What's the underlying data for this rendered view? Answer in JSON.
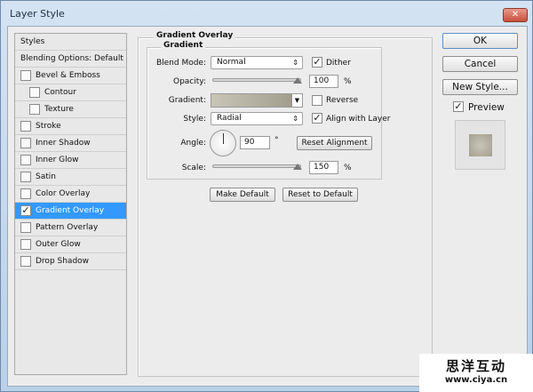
{
  "window": {
    "title": "Layer Style",
    "close": "✕"
  },
  "sidebar": {
    "items": [
      {
        "label": "Styles",
        "checkbox": false
      },
      {
        "label": "Blending Options: Default",
        "checkbox": false
      },
      {
        "label": "Bevel & Emboss",
        "checkbox": true,
        "checked": false
      },
      {
        "label": "Contour",
        "checkbox": true,
        "checked": false,
        "indent": true
      },
      {
        "label": "Texture",
        "checkbox": true,
        "checked": false,
        "indent": true
      },
      {
        "label": "Stroke",
        "checkbox": true,
        "checked": false
      },
      {
        "label": "Inner Shadow",
        "checkbox": true,
        "checked": false
      },
      {
        "label": "Inner Glow",
        "checkbox": true,
        "checked": false
      },
      {
        "label": "Satin",
        "checkbox": true,
        "checked": false
      },
      {
        "label": "Color Overlay",
        "checkbox": true,
        "checked": false
      },
      {
        "label": "Gradient Overlay",
        "checkbox": true,
        "checked": true,
        "selected": true
      },
      {
        "label": "Pattern Overlay",
        "checkbox": true,
        "checked": false
      },
      {
        "label": "Outer Glow",
        "checkbox": true,
        "checked": false
      },
      {
        "label": "Drop Shadow",
        "checkbox": true,
        "checked": false
      }
    ]
  },
  "panel": {
    "title": "Gradient Overlay",
    "group": "Gradient",
    "blend_mode_label": "Blend Mode:",
    "blend_mode": "Normal",
    "dither_label": "Dither",
    "dither": true,
    "opacity_label": "Opacity:",
    "opacity": "100",
    "opacity_unit": "%",
    "gradient_label": "Gradient:",
    "gradient_colors": [
      "#c8c5b7",
      "#a39f8f"
    ],
    "reverse_label": "Reverse",
    "reverse": false,
    "style_label": "Style:",
    "style": "Radial",
    "align_label": "Align with Layer",
    "align": true,
    "angle_label": "Angle:",
    "angle": "90",
    "angle_unit": "°",
    "reset_alignment": "Reset Alignment",
    "scale_label": "Scale:",
    "scale": "150",
    "scale_unit": "%",
    "make_default": "Make Default",
    "reset_default": "Reset to Default"
  },
  "actions": {
    "ok": "OK",
    "cancel": "Cancel",
    "new_style": "New Style...",
    "preview_label": "Preview",
    "preview": true
  },
  "watermark": {
    "line1": "思洋互动",
    "line2": "www.ciya.cn"
  }
}
